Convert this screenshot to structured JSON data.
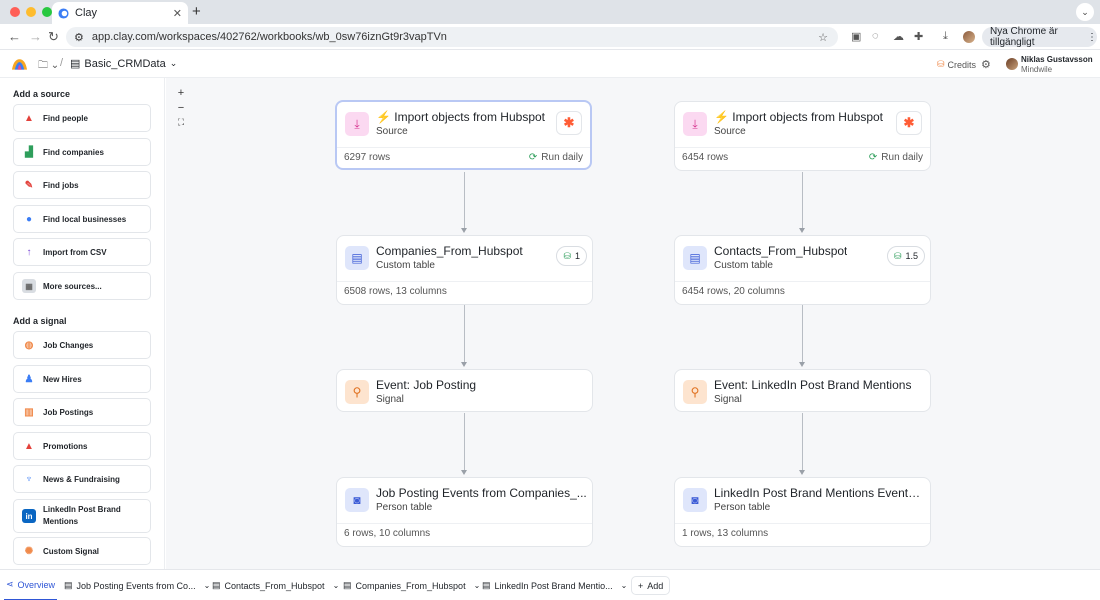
{
  "browser": {
    "tab_title": "Clay",
    "url": "app.clay.com/workspaces/402762/workbooks/wb_0sw76iznGt9r3vapTVn",
    "update_pill": "Nya Chrome är tillgängligt"
  },
  "header": {
    "workbook_name": "Basic_CRMData",
    "credits_label": "Credits",
    "user_name": "Niklas Gustavsson",
    "user_org": "Mindwile"
  },
  "sidebar": {
    "add_source_title": "Add a source",
    "sources": [
      {
        "label": "Find people",
        "icon": "person-icon"
      },
      {
        "label": "Find companies",
        "icon": "building-icon"
      },
      {
        "label": "Find jobs",
        "icon": "briefcase-icon"
      },
      {
        "label": "Find local businesses",
        "icon": "map-pin-icon"
      },
      {
        "label": "Import from CSV",
        "icon": "upload-icon"
      },
      {
        "label": "More sources...",
        "icon": "grid-icon"
      }
    ],
    "add_signal_title": "Add a signal",
    "signals": [
      {
        "label": "Job Changes",
        "icon": "globe-icon"
      },
      {
        "label": "New Hires",
        "icon": "person-plus-icon"
      },
      {
        "label": "Job Postings",
        "icon": "crate-icon"
      },
      {
        "label": "Promotions",
        "icon": "pyramid-icon"
      },
      {
        "label": "News & Fundraising",
        "icon": "megaphone-icon"
      },
      {
        "label": "LinkedIn Post Brand Mentions",
        "icon": "linkedin-icon"
      },
      {
        "label": "Custom Signal",
        "icon": "sparkle-icon"
      }
    ]
  },
  "nodes": {
    "hubspot_a": {
      "title": "⚡ Import objects from Hubspot",
      "subtitle": "Source",
      "footer": "6297 rows",
      "run": "Run daily"
    },
    "hubspot_b": {
      "title": "⚡ Import objects from Hubspot",
      "subtitle": "Source",
      "footer": "6454 rows",
      "run": "Run daily"
    },
    "companies": {
      "title": "Companies_From_Hubspot",
      "subtitle": "Custom table",
      "footer": "6508 rows, 13 columns",
      "credits": "1"
    },
    "contacts": {
      "title": "Contacts_From_Hubspot",
      "subtitle": "Custom table",
      "footer": "6454 rows, 20 columns",
      "credits": "1.5"
    },
    "event_job": {
      "title": "Event: Job Posting",
      "subtitle": "Signal"
    },
    "event_li": {
      "title": "Event: LinkedIn Post Brand Mentions",
      "subtitle": "Signal"
    },
    "job_events": {
      "title": "Job Posting Events from Companies_...",
      "subtitle": "Person table",
      "footer": "6 rows, 10 columns"
    },
    "li_events": {
      "title": "LinkedIn Post Brand Mentions Events f...",
      "subtitle": "Person table",
      "footer": "1 rows, 13 columns"
    }
  },
  "bottom_tabs": [
    {
      "label": "Overview"
    },
    {
      "label": "Job Posting Events from Co..."
    },
    {
      "label": "Contacts_From_Hubspot"
    },
    {
      "label": "Companies_From_Hubspot"
    },
    {
      "label": "LinkedIn Post Brand Mentio..."
    }
  ],
  "add_tab_label": "Add",
  "colors": {
    "accent": "#2f56d6",
    "selected_border": "#b9c8f4",
    "source_icon_bg": "#fbd9f1",
    "table_icon_bg": "#dfe6fb",
    "signal_icon_bg": "#fde4cf"
  }
}
